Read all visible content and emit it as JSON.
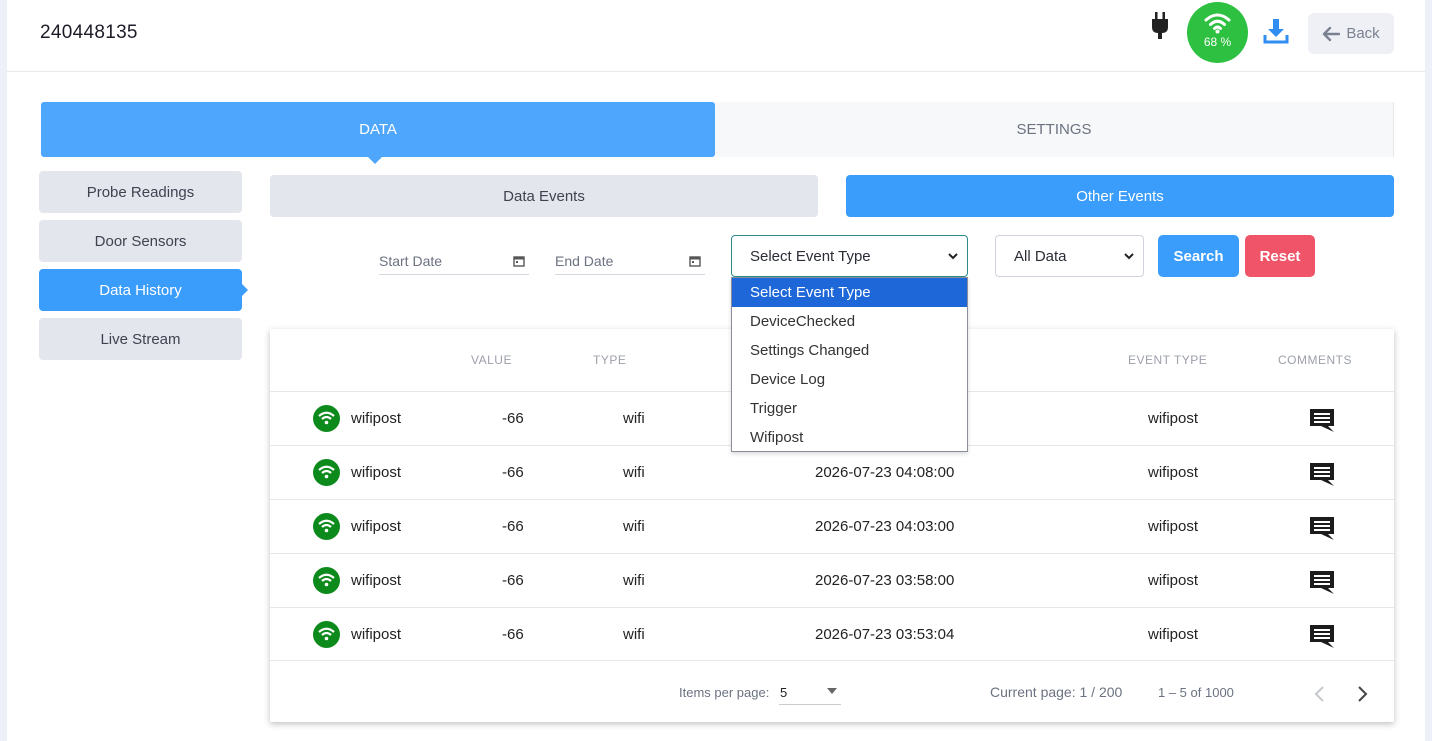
{
  "header": {
    "device_id": "240448135",
    "wifi_percent": "68 %",
    "back_label": "Back",
    "icons": [
      "plug-icon",
      "wifi-icon",
      "download-icon",
      "arrow-left-icon"
    ],
    "colors": {
      "wifi_ok": "#2ec040",
      "accent": "#3a9cfb",
      "danger": "#f05468"
    }
  },
  "tabs": {
    "data": "DATA",
    "settings": "SETTINGS",
    "active": "DATA"
  },
  "sidebar": {
    "items": [
      {
        "label": "Probe Readings"
      },
      {
        "label": "Door Sensors"
      },
      {
        "label": "Data History"
      },
      {
        "label": "Live Stream"
      }
    ],
    "active": "Data History"
  },
  "subtabs": {
    "data_events": "Data Events",
    "other_events": "Other Events",
    "active": "Other Events"
  },
  "filters": {
    "start_date": "Start Date",
    "end_date": "End Date",
    "event_type": "Select Event Type",
    "data_scope": "All Data",
    "search_label": "Search",
    "reset_label": "Reset"
  },
  "dropdown": {
    "options": [
      "Select Event Type",
      "DeviceChecked",
      "Settings Changed",
      "Device Log",
      "Trigger",
      "Wifipost"
    ],
    "highlighted": "Select Event Type"
  },
  "table": {
    "headers": {
      "value": "VALUE",
      "type": "TYPE",
      "event_type": "EVENT TYPE",
      "comments": "COMMENTS"
    },
    "rows": [
      {
        "name": "wifipost",
        "value": "-66",
        "type": "wifi",
        "time": "",
        "event_type": "wifipost"
      },
      {
        "name": "wifipost",
        "value": "-66",
        "type": "wifi",
        "time": "2026-07-23 04:08:00",
        "event_type": "wifipost"
      },
      {
        "name": "wifipost",
        "value": "-66",
        "type": "wifi",
        "time": "2026-07-23 04:03:00",
        "event_type": "wifipost"
      },
      {
        "name": "wifipost",
        "value": "-66",
        "type": "wifi",
        "time": "2026-07-23 03:58:00",
        "event_type": "wifipost"
      },
      {
        "name": "wifipost",
        "value": "-66",
        "type": "wifi",
        "time": "2026-07-23 03:53:04",
        "event_type": "wifipost"
      }
    ]
  },
  "pagination": {
    "items_per_page_label": "Items per page:",
    "items_per_page": "5",
    "current_page": "Current page: 1 / 200",
    "range": "1 – 5 of 1000"
  }
}
